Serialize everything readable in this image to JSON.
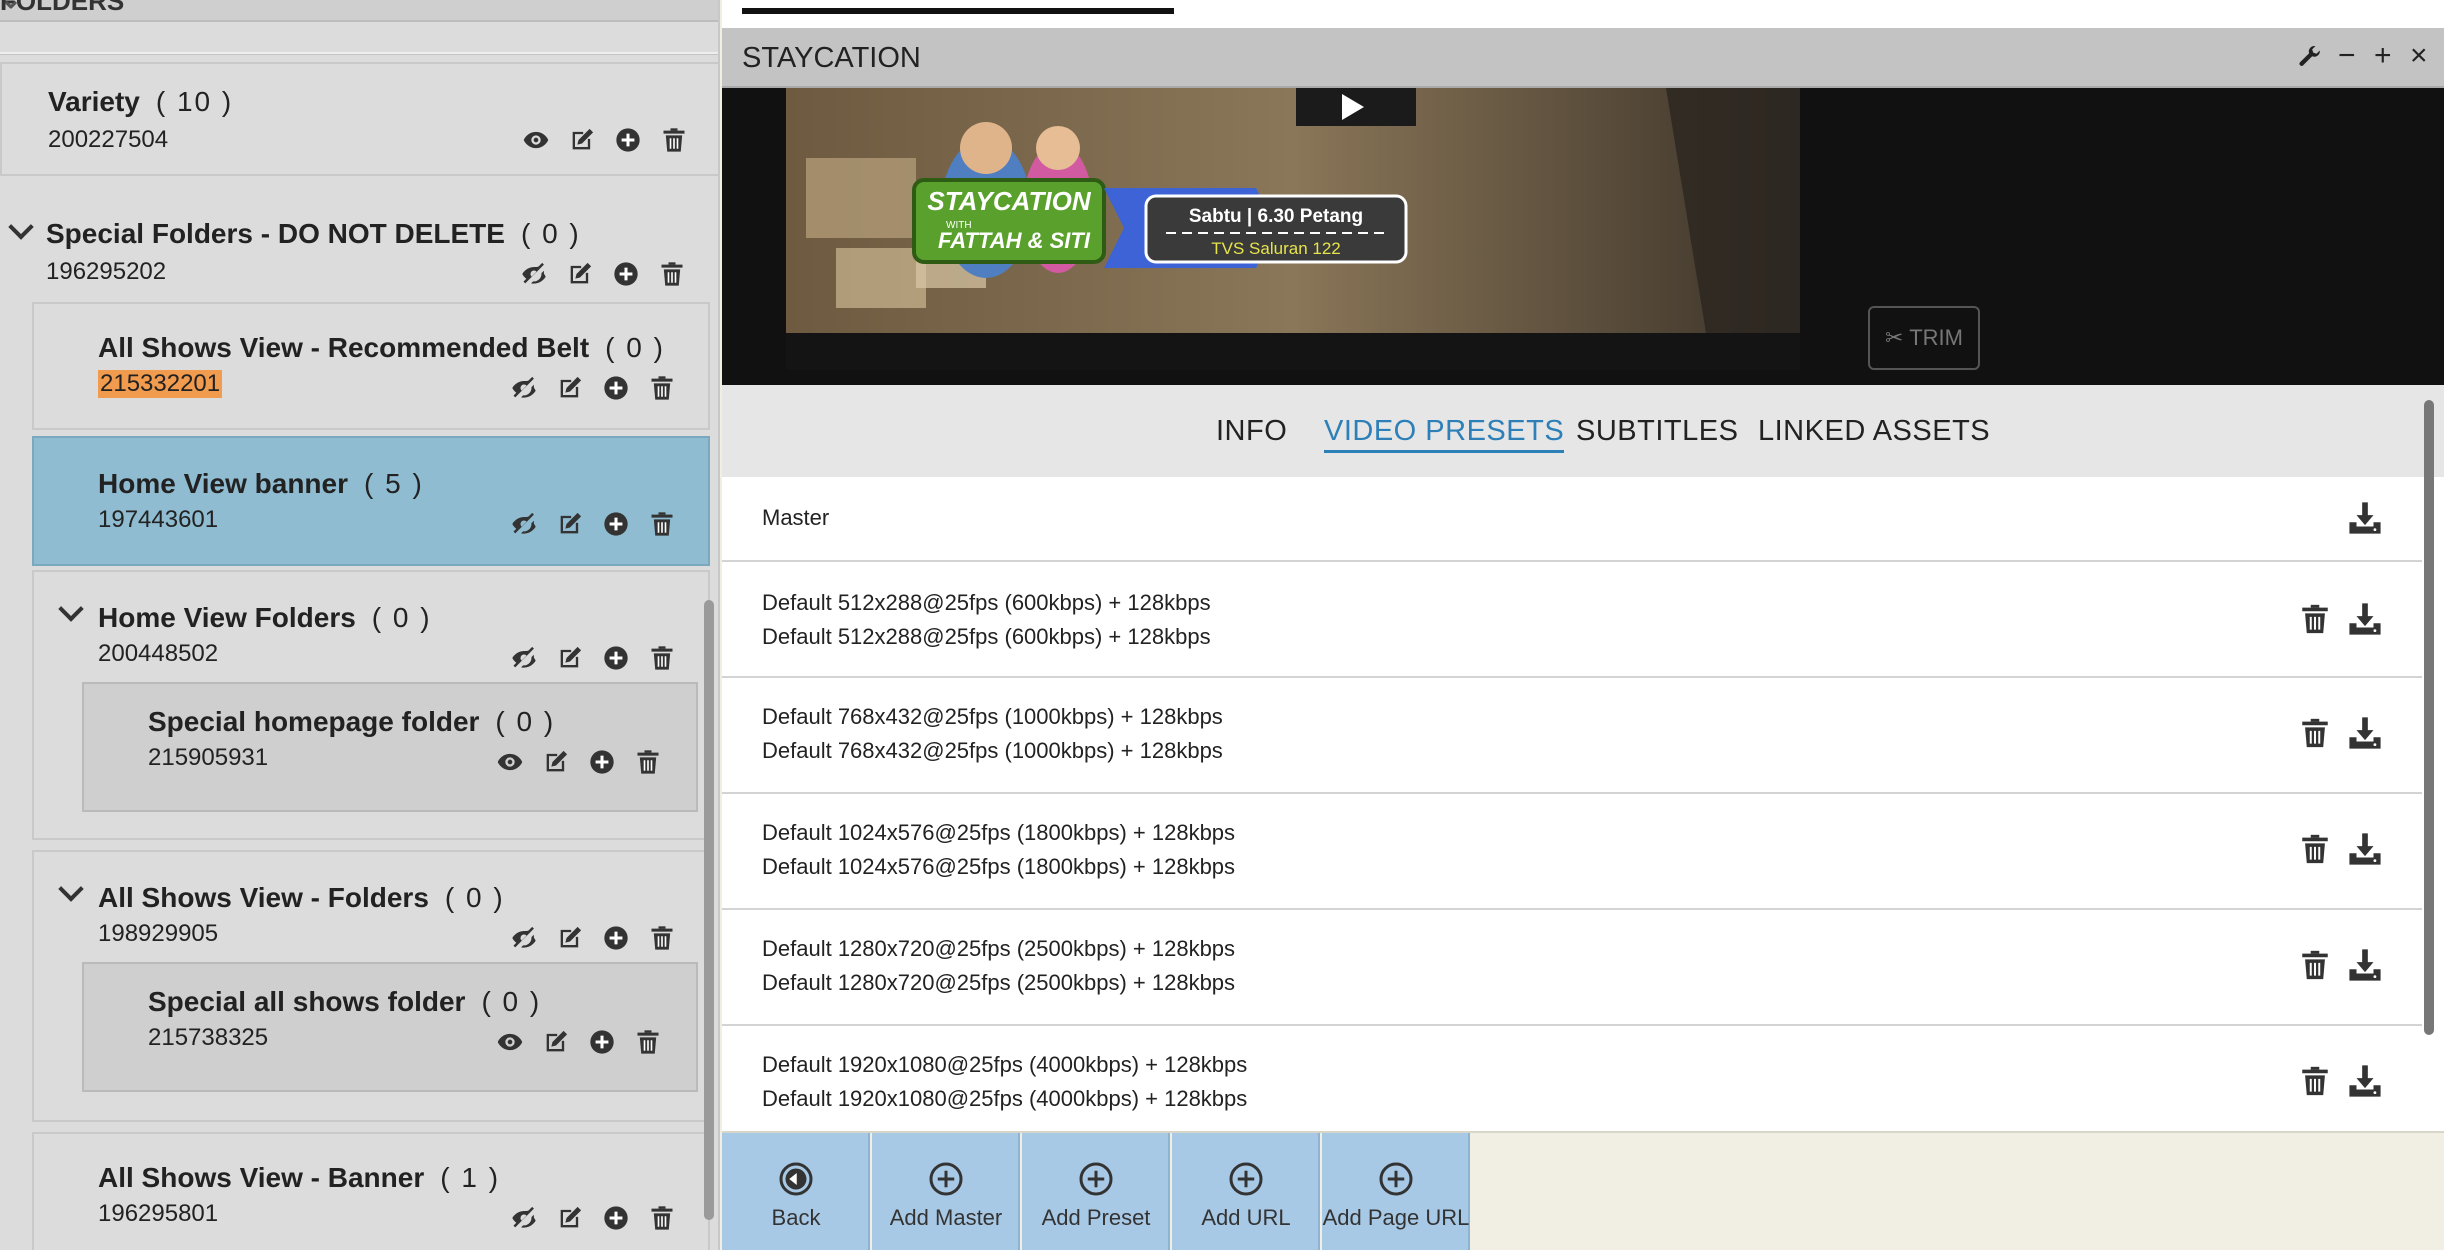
{
  "left_panel": {
    "header": "FOLDERS",
    "folders": [
      {
        "name": "Variety",
        "count": "( 10 )",
        "id": "200227504"
      },
      {
        "name": "Special Folders - DO NOT DELETE",
        "count": "( 0 )",
        "id": "196295202"
      },
      {
        "name": "All Shows View - Recommended Belt",
        "count": "( 0 )",
        "id": "215332201"
      },
      {
        "name": "Home View banner",
        "count": "( 5 )",
        "id": "197443601"
      },
      {
        "name": "Home View Folders",
        "count": "( 0 )",
        "id": "200448502"
      },
      {
        "name": "Special homepage folder",
        "count": "( 0 )",
        "id": "215905931"
      },
      {
        "name": "All Shows View - Folders",
        "count": "( 0 )",
        "id": "198929905"
      },
      {
        "name": "Special all shows folder",
        "count": "( 0 )",
        "id": "215738325"
      },
      {
        "name": "All Shows View - Banner",
        "count": "( 1 )",
        "id": "196295801"
      }
    ]
  },
  "window": {
    "title": "STAYCATION",
    "controls": {
      "settings": "wrench-icon",
      "minimize": "−",
      "maximize": "+",
      "close": "×"
    }
  },
  "video": {
    "banner_title": "STAYCATION",
    "banner_with": "WITH",
    "banner_hosts": "FATTAH & SITI",
    "schedule": "Sabtu | 6.30 Petang",
    "channel": "TVS Saluran 122",
    "trim_label": "TRIM"
  },
  "tabs": [
    "INFO",
    "VIDEO PRESETS",
    "SUBTITLES",
    "LINKED ASSETS"
  ],
  "active_tab": "VIDEO PRESETS",
  "presets": [
    {
      "line1": "Master",
      "line2": ""
    },
    {
      "line1": "Default 512x288@25fps (600kbps) + 128kbps",
      "line2": "Default 512x288@25fps (600kbps) + 128kbps"
    },
    {
      "line1": "Default 768x432@25fps (1000kbps) + 128kbps",
      "line2": "Default 768x432@25fps (1000kbps) + 128kbps"
    },
    {
      "line1": "Default 1024x576@25fps (1800kbps) + 128kbps",
      "line2": "Default 1024x576@25fps (1800kbps) + 128kbps"
    },
    {
      "line1": "Default 1280x720@25fps (2500kbps) + 128kbps",
      "line2": "Default 1280x720@25fps (2500kbps) + 128kbps"
    },
    {
      "line1": "Default 1920x1080@25fps (4000kbps) + 128kbps",
      "line2": "Default 1920x1080@25fps (4000kbps) + 128kbps"
    }
  ],
  "toolbar": {
    "back": "Back",
    "add_master": "Add Master",
    "add_preset": "Add Preset",
    "add_url": "Add URL",
    "add_page_url": "Add Page URL"
  },
  "colors": {
    "accent": "#2d7fb8",
    "active_folder": "#8fbcd0",
    "id_highlight": "#f19b4e",
    "toolbar_button": "#a8c9e6"
  }
}
